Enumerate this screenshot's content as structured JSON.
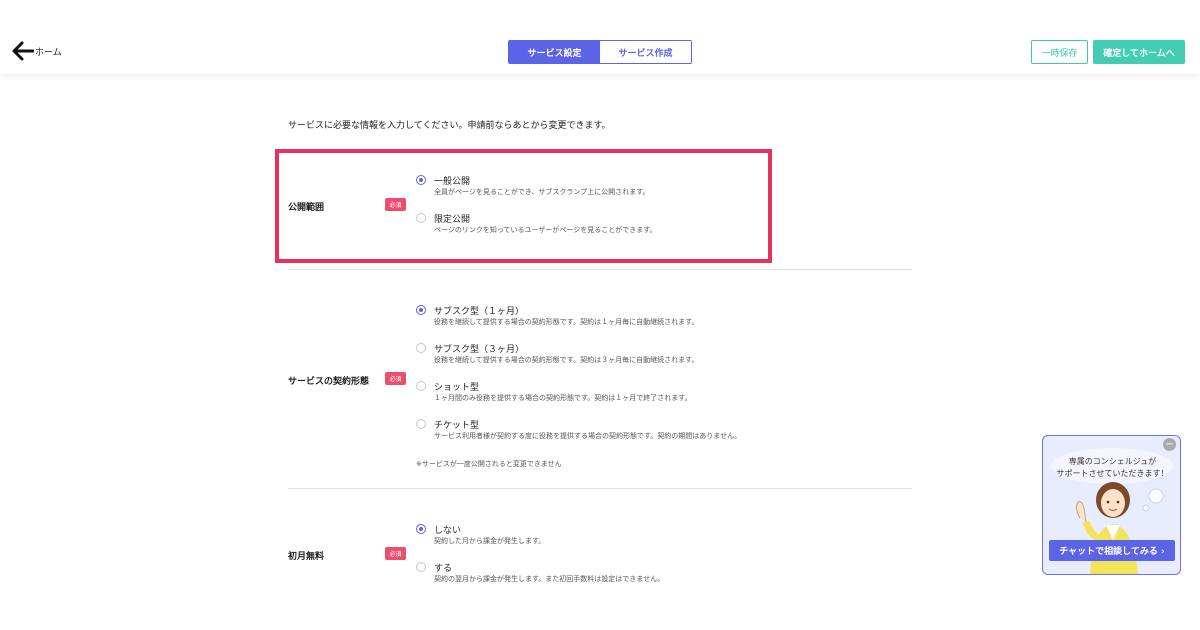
{
  "header": {
    "back_label": "ホーム",
    "tabs": [
      {
        "label": "サービス設定",
        "active": true
      },
      {
        "label": "サービス作成",
        "active": false
      }
    ],
    "save_label": "一時保存",
    "confirm_label": "確定してホームへ"
  },
  "intro": "サービスに必要な情報を入力してください。申請前ならあとから変更できます。",
  "required_badge": "必須",
  "sections": {
    "visibility": {
      "label": "公開範囲",
      "options": [
        {
          "title": "一般公開",
          "desc": "全員がページを見ることができ、サブスクランプ上に公開されます。",
          "selected": true
        },
        {
          "title": "限定公開",
          "desc": "ページのリンクを知っているユーザーがページを見ることができます。",
          "selected": false
        }
      ]
    },
    "contract": {
      "label": "サービスの契約形態",
      "options": [
        {
          "title": "サブスク型（１ヶ月）",
          "desc": "役務を継続して提供する場合の契約形態です。契約は１ヶ月毎に自動継続されます。",
          "selected": true
        },
        {
          "title": "サブスク型（３ヶ月）",
          "desc": "役務を継続して提供する場合の契約形態です。契約は３ヶ月毎に自動継続されます。",
          "selected": false
        },
        {
          "title": "ショット型",
          "desc": "１ヶ月間のみ役務を提供する場合の契約形態です。契約は１ヶ月で終了されます。",
          "selected": false
        },
        {
          "title": "チケット型",
          "desc": "サービス利用者様が契約する度に役務を提供する場合の契約形態です。契約の期間はありません。",
          "selected": false
        }
      ],
      "note": "※サービスが一度公開されると変更できません"
    },
    "first_month": {
      "label": "初月無料",
      "options": [
        {
          "title": "しない",
          "desc": "契約した月から課金が発生します。",
          "selected": true
        },
        {
          "title": "する",
          "desc": "契約の翌月から課金が発生します。また初回手数料は設定はできません。",
          "selected": false
        }
      ]
    }
  },
  "chat": {
    "line1": "専属のコンシェルジュが",
    "line2": "サポートさせていただきます！",
    "button": "チャットで相談してみる ›",
    "close": "−"
  },
  "colors": {
    "accent": "#5b63e6",
    "teal": "#43cdb2",
    "highlight": "#e8325e",
    "required": "#ec4e6e"
  }
}
